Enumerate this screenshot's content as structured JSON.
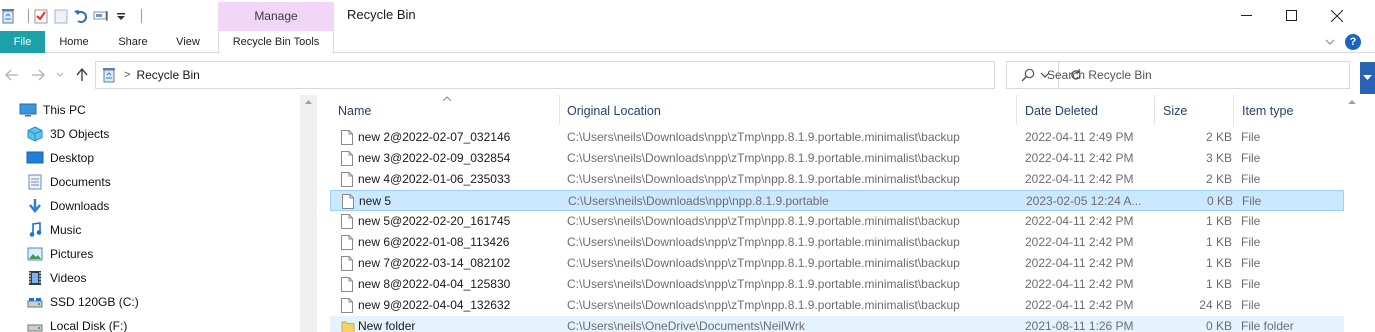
{
  "window": {
    "title": "Recycle Bin",
    "manage_label": "Manage"
  },
  "quick_access": {
    "icons": [
      "recycle-bin-icon",
      "properties-check-icon",
      "new-folder-icon",
      "undo-icon",
      "rename-icon",
      "customize-chevron-icon"
    ]
  },
  "ribbon": {
    "tabs": [
      {
        "label": "File"
      },
      {
        "label": "Home"
      },
      {
        "label": "Share"
      },
      {
        "label": "View"
      },
      {
        "label": "Recycle Bin Tools"
      }
    ]
  },
  "address": {
    "path": "Recycle Bin",
    "separator": ">"
  },
  "search": {
    "placeholder": "Search Recycle Bin"
  },
  "nav": {
    "items": [
      {
        "label": "This PC",
        "icon": "this-pc-icon"
      },
      {
        "label": "3D Objects",
        "icon": "3d-objects-icon"
      },
      {
        "label": "Desktop",
        "icon": "desktop-icon"
      },
      {
        "label": "Documents",
        "icon": "documents-icon"
      },
      {
        "label": "Downloads",
        "icon": "downloads-icon"
      },
      {
        "label": "Music",
        "icon": "music-icon"
      },
      {
        "label": "Pictures",
        "icon": "pictures-icon"
      },
      {
        "label": "Videos",
        "icon": "videos-icon"
      },
      {
        "label": "SSD 120GB (C:)",
        "icon": "drive-icon"
      },
      {
        "label": "Local Disk (F:)",
        "icon": "drive-icon"
      }
    ]
  },
  "columns": {
    "name": "Name",
    "location": "Original Location",
    "date": "Date Deleted",
    "size": "Size",
    "type": "Item type"
  },
  "files": [
    {
      "name": "new 2@2022-02-07_032146",
      "location": "C:\\Users\\neils\\Downloads\\npp\\zTmp\\npp.8.1.9.portable.minimalist\\backup",
      "date": "2022-04-11 2:49 PM",
      "size": "2 KB",
      "type": "File"
    },
    {
      "name": "new 3@2022-02-09_032854",
      "location": "C:\\Users\\neils\\Downloads\\npp\\zTmp\\npp.8.1.9.portable.minimalist\\backup",
      "date": "2022-04-11 2:42 PM",
      "size": "3 KB",
      "type": "File"
    },
    {
      "name": "new 4@2022-01-06_235033",
      "location": "C:\\Users\\neils\\Downloads\\npp\\zTmp\\npp.8.1.9.portable.minimalist\\backup",
      "date": "2022-04-11 2:42 PM",
      "size": "2 KB",
      "type": "File"
    },
    {
      "name": "new 5",
      "location": "C:\\Users\\neils\\Downloads\\npp\\npp.8.1.9.portable",
      "date": "2023-02-05 12:24 A...",
      "size": "0 KB",
      "type": "File"
    },
    {
      "name": "new 5@2022-02-20_161745",
      "location": "C:\\Users\\neils\\Downloads\\npp\\zTmp\\npp.8.1.9.portable.minimalist\\backup",
      "date": "2022-04-11 2:42 PM",
      "size": "1 KB",
      "type": "File"
    },
    {
      "name": "new 6@2022-01-08_113426",
      "location": "C:\\Users\\neils\\Downloads\\npp\\zTmp\\npp.8.1.9.portable.minimalist\\backup",
      "date": "2022-04-11 2:42 PM",
      "size": "1 KB",
      "type": "File"
    },
    {
      "name": "new 7@2022-03-14_082102",
      "location": "C:\\Users\\neils\\Downloads\\npp\\zTmp\\npp.8.1.9.portable.minimalist\\backup",
      "date": "2022-04-11 2:42 PM",
      "size": "1 KB",
      "type": "File"
    },
    {
      "name": "new 8@2022-04-04_125830",
      "location": "C:\\Users\\neils\\Downloads\\npp\\zTmp\\npp.8.1.9.portable.minimalist\\backup",
      "date": "2022-04-11 2:42 PM",
      "size": "1 KB",
      "type": "File"
    },
    {
      "name": "new 9@2022-04-04_132632",
      "location": "C:\\Users\\neils\\Downloads\\npp\\zTmp\\npp.8.1.9.portable.minimalist\\backup",
      "date": "2022-04-11 2:42 PM",
      "size": "24 KB",
      "type": "File"
    },
    {
      "name": "New folder",
      "location": "C:\\Users\\neils\\OneDrive\\Documents\\NeilWrk",
      "date": "2021-08-11 1:26 PM",
      "size": "0 KB",
      "type": "File folder"
    }
  ],
  "colors": {
    "file_tab": "#1aa1a9",
    "manage_tab": "#f1d6f8",
    "selection": "#cce8ff",
    "hover": "#e5f3ff"
  }
}
